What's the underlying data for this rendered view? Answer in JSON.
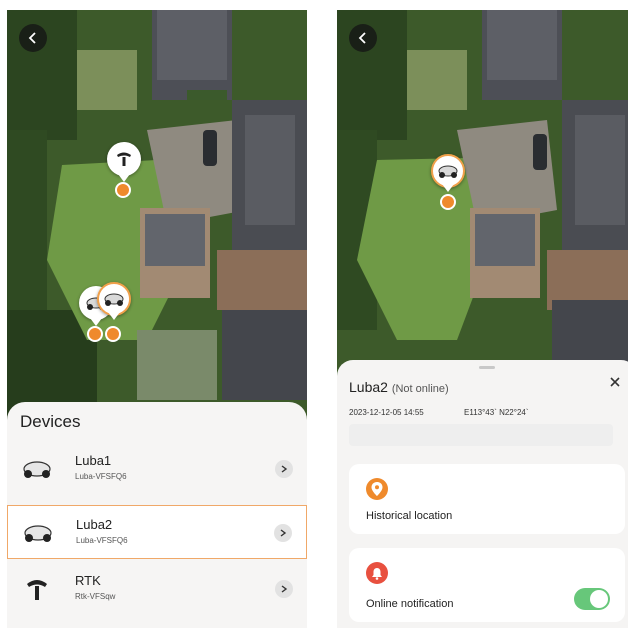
{
  "left_screen": {
    "sheet_title": "Devices",
    "devices": [
      {
        "name": "Luba1",
        "serial": "Luba-VFSFQ6",
        "icon": "mower-icon",
        "selected": false
      },
      {
        "name": "Luba2",
        "serial": "Luba-VFSFQ6",
        "icon": "mower-icon",
        "selected": true
      },
      {
        "name": "RTK",
        "serial": "Rtk-VFSqw",
        "icon": "rtk-antenna-icon",
        "selected": false
      }
    ]
  },
  "right_screen": {
    "device_name": "Luba2",
    "device_status": "(Not online)",
    "timestamp": "2023-12-12-05 14:55",
    "coordinates": "E113°43` N22°24`",
    "historical_location_label": "Historical location",
    "online_notification_label": "Online notification",
    "online_notification_enabled": true
  },
  "colors": {
    "accent_orange": "#ef8a2c",
    "alert_red": "#e8503f",
    "toggle_green": "#67c77a"
  }
}
